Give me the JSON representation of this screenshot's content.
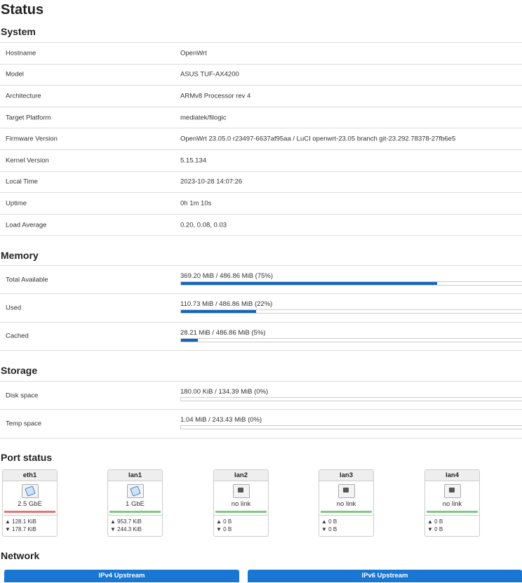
{
  "page_title": "Status",
  "system": {
    "heading": "System",
    "rows": [
      {
        "label": "Hostname",
        "value": "OpenWrt"
      },
      {
        "label": "Model",
        "value": "ASUS TUF-AX4200"
      },
      {
        "label": "Architecture",
        "value": "ARMv8 Processor rev 4"
      },
      {
        "label": "Target Platform",
        "value": "mediatek/filogic"
      },
      {
        "label": "Firmware Version",
        "value": "OpenWrt 23.05.0 r23497-6637af95aa / LuCI openwrt-23.05 branch git-23.292.78378-27fb6e5"
      },
      {
        "label": "Kernel Version",
        "value": "5.15.134"
      },
      {
        "label": "Local Time",
        "value": "2023-10-28 14:07:26"
      },
      {
        "label": "Uptime",
        "value": "0h 1m 10s"
      },
      {
        "label": "Load Average",
        "value": "0.20, 0.08, 0.03"
      }
    ]
  },
  "memory": {
    "heading": "Memory",
    "rows": [
      {
        "label": "Total Available",
        "value": "369.20 MiB / 486.86 MiB (75%)",
        "fraction": 0.75
      },
      {
        "label": "Used",
        "value": "110.73 MiB / 486.86 MiB (22%)",
        "fraction": 0.22
      },
      {
        "label": "Cached",
        "value": "28.21 MiB / 486.86 MiB (5%)",
        "fraction": 0.05
      }
    ]
  },
  "storage": {
    "heading": "Storage",
    "rows": [
      {
        "label": "Disk space",
        "value": "180.00 KiB / 134.39 MiB (0%)",
        "fraction": 0.0
      },
      {
        "label": "Temp space",
        "value": "1.04 MiB / 243.43 MiB (0%)",
        "fraction": 0.0
      }
    ]
  },
  "port_status": {
    "heading": "Port status",
    "ports": [
      {
        "name": "eth1",
        "speed": "2.5 GbE",
        "icon": "ethernet-port-up-icon",
        "link_color": "#e57373",
        "tx": "▲ 128.1 KiB",
        "rx": "▼ 178.7 KiB"
      },
      {
        "name": "lan1",
        "speed": "1 GbE",
        "icon": "ethernet-port-up-icon",
        "link_color": "#81c784",
        "tx": "▲ 953.7 KiB",
        "rx": "▼ 244.3 KiB"
      },
      {
        "name": "lan2",
        "speed": "no link",
        "icon": "ethernet-port-down-icon",
        "link_color": "#81c784",
        "tx": "▲ 0 B",
        "rx": "▼ 0 B"
      },
      {
        "name": "lan3",
        "speed": "no link",
        "icon": "ethernet-port-down-icon",
        "link_color": "#81c784",
        "tx": "▲ 0 B",
        "rx": "▼ 0 B"
      },
      {
        "name": "lan4",
        "speed": "no link",
        "icon": "ethernet-port-down-icon",
        "link_color": "#81c784",
        "tx": "▲ 0 B",
        "rx": "▼ 0 B"
      }
    ]
  },
  "network": {
    "heading": "Network",
    "ipv4_title": "IPv4 Upstream",
    "ipv6_title": "IPv6 Upstream"
  },
  "colors": {
    "accent": "#1976d2",
    "progress": "#1565c0"
  }
}
